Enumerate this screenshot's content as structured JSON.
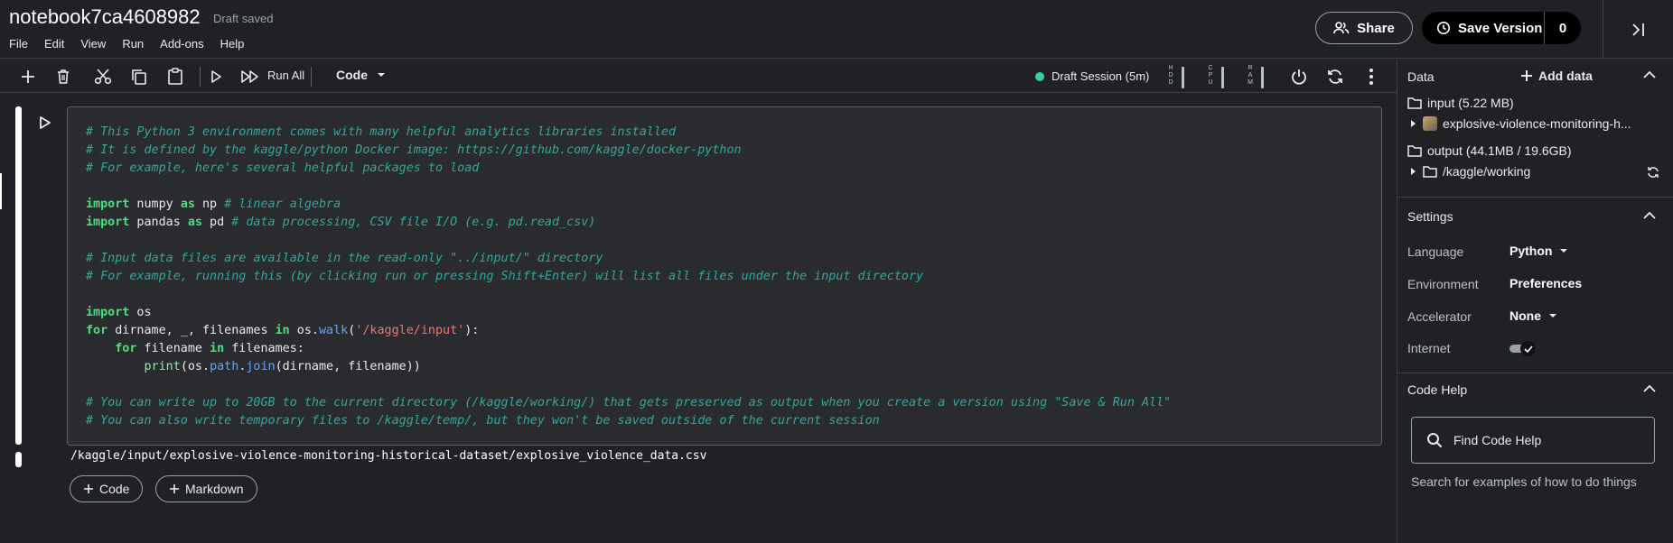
{
  "header": {
    "title": "notebook7ca4608982",
    "status": "Draft saved",
    "menu": [
      "File",
      "Edit",
      "View",
      "Run",
      "Add-ons",
      "Help"
    ],
    "share_label": "Share",
    "save_version_label": "Save Version",
    "save_version_count": "0"
  },
  "toolbar": {
    "run_all_label": "Run All",
    "cell_type": "Code",
    "session_label": "Draft Session (5m)",
    "meters": [
      "HDD",
      "CPU",
      "RAM"
    ],
    "session_color": "#34d399"
  },
  "cell": {
    "code_lines": [
      "# This Python 3 environment comes with many helpful analytics libraries installed",
      "# It is defined by the kaggle/python Docker image: https://github.com/kaggle/docker-python",
      "# For example, here's several helpful packages to load",
      "",
      "import numpy as np # linear algebra",
      "import pandas as pd # data processing, CSV file I/O (e.g. pd.read_csv)",
      "",
      "# Input data files are available in the read-only \"../input/\" directory",
      "# For example, running this (by clicking run or pressing Shift+Enter) will list all files under the input directory",
      "",
      "import os",
      "for dirname, _, filenames in os.walk('/kaggle/input'):",
      "    for filename in filenames:",
      "        print(os.path.join(dirname, filename))",
      "",
      "# You can write up to 20GB to the current directory (/kaggle/working/) that gets preserved as output when you create a version using \"Save & Run All\"",
      "# You can also write temporary files to /kaggle/temp/, but they won't be saved outside of the current session"
    ],
    "output": "/kaggle/input/explosive-violence-monitoring-historical-dataset/explosive_violence_data.csv"
  },
  "add_cell": {
    "code_label": "Code",
    "markdown_label": "Markdown"
  },
  "sidebar": {
    "data": {
      "title": "Data",
      "add_label": "Add data",
      "input_label": "input (5.22 MB)",
      "input_dataset": "explosive-violence-monitoring-h...",
      "output_label": "output (44.1MB / 19.6GB)",
      "output_dir": "/kaggle/working"
    },
    "settings": {
      "title": "Settings",
      "language_label": "Language",
      "language_value": "Python",
      "environment_label": "Environment",
      "environment_value": "Preferences",
      "accelerator_label": "Accelerator",
      "accelerator_value": "None",
      "internet_label": "Internet"
    },
    "code_help": {
      "title": "Code Help",
      "search_label": "Find Code Help",
      "hint": "Search for examples of how to do things"
    }
  }
}
